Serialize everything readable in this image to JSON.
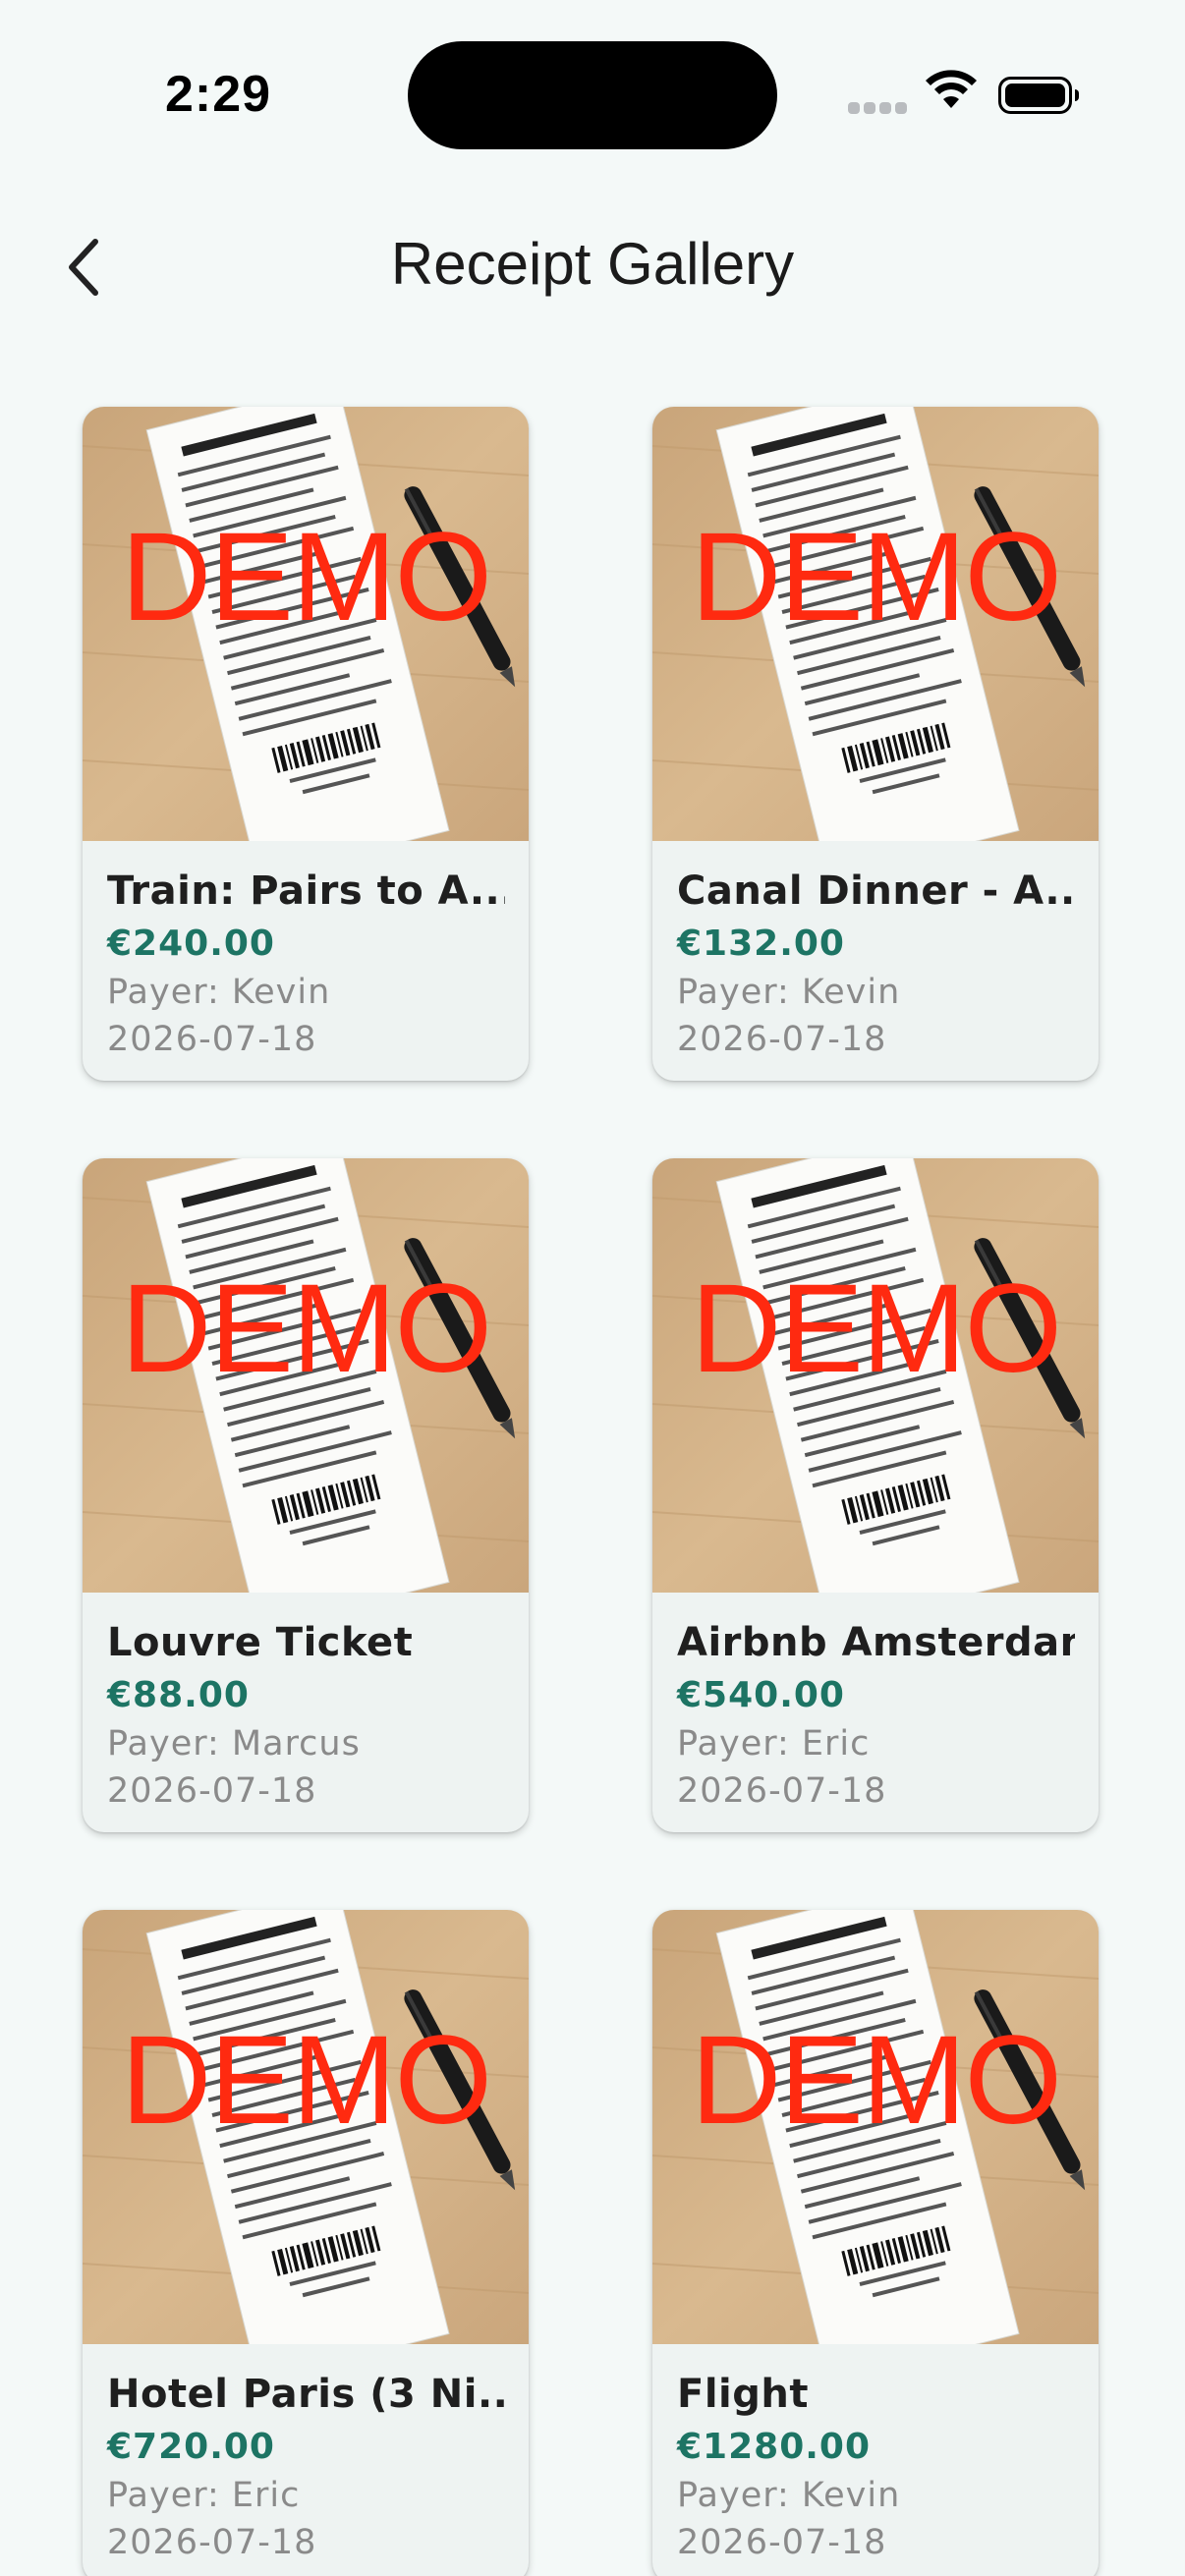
{
  "status_bar": {
    "time": "2:29"
  },
  "header": {
    "title": "Receipt Gallery",
    "back_icon": "chevron-left-icon"
  },
  "colors": {
    "background": "#f4f9f8",
    "card": "#eef3f2",
    "amount": "#1d7464",
    "demo_watermark": "#ff2a10",
    "muted_text": "#8a8a8a"
  },
  "receipts": [
    {
      "title": "Train: Pairs to A...",
      "amount": "€240.00",
      "payer": "Payer: Kevin",
      "date": "2026-07-18",
      "watermark": "DEMO"
    },
    {
      "title": "Canal Dinner - A...",
      "amount": "€132.00",
      "payer": "Payer: Kevin",
      "date": "2026-07-18",
      "watermark": "DEMO"
    },
    {
      "title": "Louvre Ticket",
      "amount": "€88.00",
      "payer": "Payer: Marcus",
      "date": "2026-07-18",
      "watermark": "DEMO"
    },
    {
      "title": "Airbnb Amsterdam",
      "amount": "€540.00",
      "payer": "Payer: Eric",
      "date": "2026-07-18",
      "watermark": "DEMO"
    },
    {
      "title": "Hotel Paris (3 Ni...",
      "amount": "€720.00",
      "payer": "Payer: Eric",
      "date": "2026-07-18",
      "watermark": "DEMO"
    },
    {
      "title": "Flight",
      "amount": "€1280.00",
      "payer": "Payer: Kevin",
      "date": "2026-07-18",
      "watermark": "DEMO"
    }
  ]
}
